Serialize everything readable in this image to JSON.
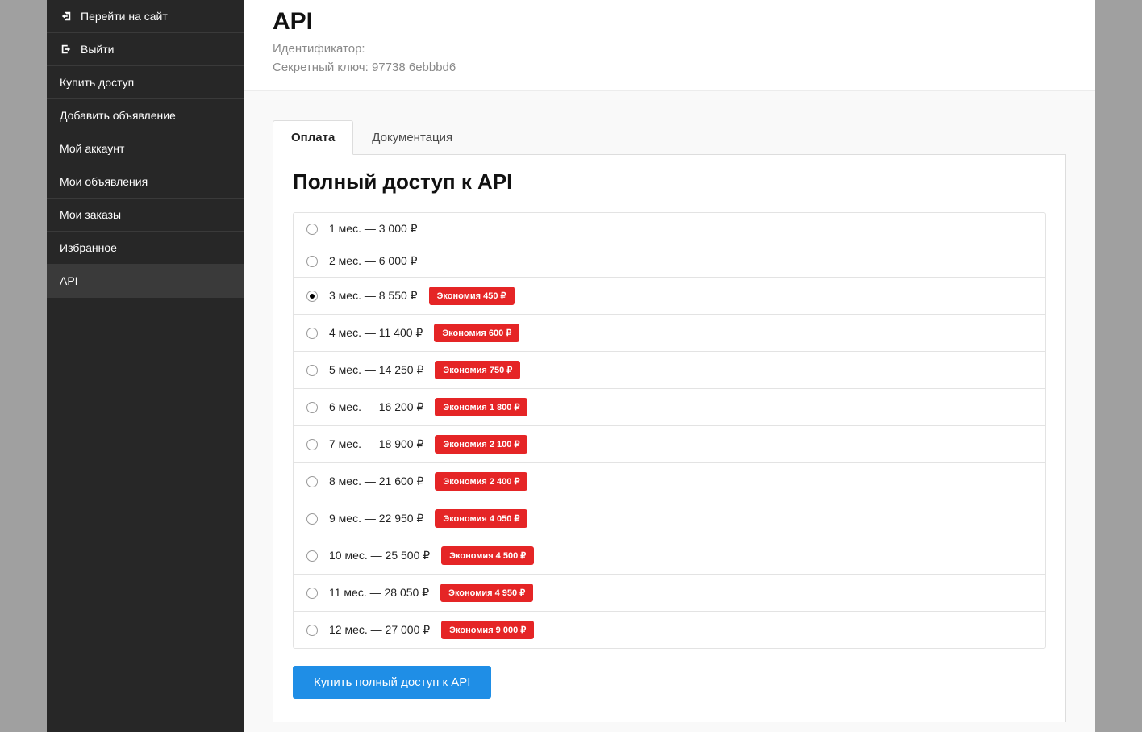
{
  "sidebar": {
    "items": [
      {
        "id": "go-to-site",
        "icon": "enter",
        "label": "Перейти на сайт"
      },
      {
        "id": "logout",
        "icon": "exit",
        "label": "Выйти"
      },
      {
        "id": "buy-access",
        "icon": "",
        "label": "Купить доступ"
      },
      {
        "id": "add-listing",
        "icon": "",
        "label": "Добавить объявление"
      },
      {
        "id": "my-account",
        "icon": "",
        "label": "Мой аккаунт"
      },
      {
        "id": "my-listings",
        "icon": "",
        "label": "Мои объявления"
      },
      {
        "id": "my-orders",
        "icon": "",
        "label": "Мои заказы"
      },
      {
        "id": "favorites",
        "icon": "",
        "label": "Избранное"
      },
      {
        "id": "api",
        "icon": "",
        "label": "API",
        "active": true
      }
    ]
  },
  "header": {
    "title": "API",
    "identifier_label": "Идентификатор",
    "identifier_value": "",
    "secret_label": "Секретный ключ",
    "secret_value": "97738                                          6ebbbd6"
  },
  "tabs": [
    {
      "id": "payment",
      "label": "Оплата",
      "active": true
    },
    {
      "id": "docs",
      "label": "Документация"
    }
  ],
  "panel": {
    "title": "Полный доступ к API",
    "options": [
      {
        "label": "1 мес. — 3 000",
        "savings": null,
        "selected": false
      },
      {
        "label": "2 мес. — 6 000",
        "savings": null,
        "selected": false
      },
      {
        "label": "3 мес. — 8 550",
        "savings": "Экономия 450",
        "selected": true
      },
      {
        "label": "4 мес. — 11 400",
        "savings": "Экономия 600",
        "selected": false
      },
      {
        "label": "5 мес. — 14 250",
        "savings": "Экономия 750",
        "selected": false
      },
      {
        "label": "6 мес. — 16 200",
        "savings": "Экономия 1 800",
        "selected": false
      },
      {
        "label": "7 мес. — 18 900",
        "savings": "Экономия 2 100",
        "selected": false
      },
      {
        "label": "8 мес. — 21 600",
        "savings": "Экономия 2 400",
        "selected": false
      },
      {
        "label": "9 мес. — 22 950",
        "savings": "Экономия 4 050",
        "selected": false
      },
      {
        "label": "10 мес. — 25 500",
        "savings": "Экономия 4 500",
        "selected": false
      },
      {
        "label": "11 мес. — 28 050",
        "savings": "Экономия 4 950",
        "selected": false
      },
      {
        "label": "12 мес. — 27 000",
        "savings": "Экономия 9 000",
        "selected": false
      }
    ],
    "buy_button": "Купить полный доступ к API"
  }
}
